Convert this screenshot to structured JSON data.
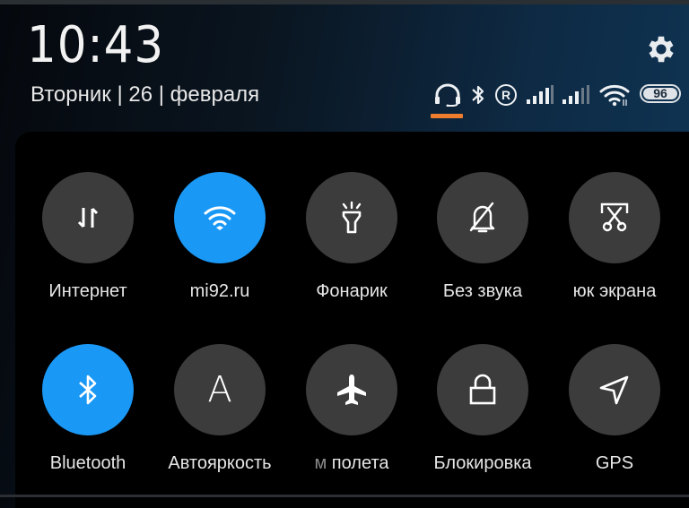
{
  "status_bar": {
    "time": "10:43",
    "date": "Вторник | 26 | февраля",
    "icons": [
      "headset-icon",
      "bluetooth-icon",
      "roaming-icon",
      "signal-sim1-icon",
      "signal-sim2-icon",
      "wifi-icon",
      "battery-icon"
    ],
    "roaming_glyph": "R",
    "battery_level": "96",
    "accent_color": "#f07d2e"
  },
  "settings": {
    "icon": "gear-icon"
  },
  "quick_settings": {
    "active_color": "#1a98f6",
    "inactive_color": "#3c3c3c",
    "rows": [
      [
        {
          "label": "Интернет",
          "icon": "mobile-data-icon",
          "active": false
        },
        {
          "label": "mi92.ru",
          "icon": "wifi-icon",
          "active": true
        },
        {
          "label": "Фонарик",
          "icon": "flashlight-icon",
          "active": false
        },
        {
          "label": "Без звука",
          "icon": "bell-off-icon",
          "active": false
        },
        {
          "label_visible": "юк экрана",
          "label_full": "Снимок экрана",
          "icon": "screenshot-icon",
          "active": false
        }
      ],
      [
        {
          "label": "Bluetooth",
          "icon": "bluetooth-icon",
          "active": true
        },
        {
          "label": "Автояркость",
          "icon": "auto-brightness-icon",
          "glyph": "A",
          "active": false
        },
        {
          "label_faded": "м",
          "label_visible": "полета",
          "label_full": "Режим полета",
          "icon": "airplane-icon",
          "active": false
        },
        {
          "label": "Блокировка",
          "icon": "lock-icon",
          "active": false
        },
        {
          "label": "GPS",
          "icon": "location-icon",
          "active": false
        }
      ]
    ]
  }
}
